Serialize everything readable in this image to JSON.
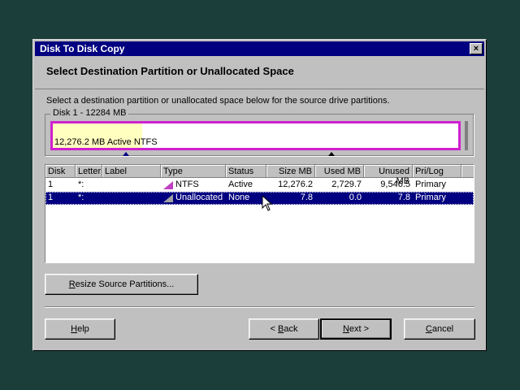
{
  "window": {
    "title": "Disk To Disk Copy",
    "close_glyph": "×"
  },
  "heading": "Select Destination Partition or Unallocated Space",
  "instruction": "Select a destination partition or unallocated space below for the source drive partitions.",
  "disk_map": {
    "label": "Disk 1 - 12284  MB",
    "bar_label": "12,276.2 MB Active NTFS",
    "used_fraction": 0.22,
    "partition_color": "#d020d0"
  },
  "table": {
    "headers": [
      "Disk",
      "Letter",
      "Label",
      "Type",
      "Status",
      "Size MB",
      "Used MB",
      "Unused MB",
      "Pri/Log"
    ],
    "rows": [
      {
        "disk": "1",
        "letter": "*:",
        "label": "",
        "type": "NTFS",
        "type_icon": "ntfs-partition-icon",
        "status": "Active",
        "size": "12,276.2",
        "used": "2,729.7",
        "unused": "9,546.5",
        "prilog": "Primary",
        "selected": false
      },
      {
        "disk": "1",
        "letter": "*:",
        "label": "",
        "type": "Unallocated",
        "type_icon": "unallocated-partition-icon",
        "status": "None",
        "size": "7.8",
        "used": "0.0",
        "unused": "7.8",
        "prilog": "Primary",
        "selected": true
      }
    ]
  },
  "buttons": {
    "resize": {
      "pre": "",
      "accel": "R",
      "post": "esize Source Partitions..."
    },
    "help": {
      "pre": "",
      "accel": "H",
      "post": "elp"
    },
    "back": {
      "pre": "< ",
      "accel": "B",
      "post": "ack"
    },
    "next": {
      "pre": "",
      "accel": "N",
      "post": "ext >"
    },
    "cancel": {
      "pre": "",
      "accel": "C",
      "post": "ancel"
    }
  },
  "colors": {
    "desktop": "#1c3e3a",
    "titlebar": "#000080",
    "selection": "#000080",
    "ntfs": "#c040c0",
    "unallocated": "#a0a0a0"
  }
}
